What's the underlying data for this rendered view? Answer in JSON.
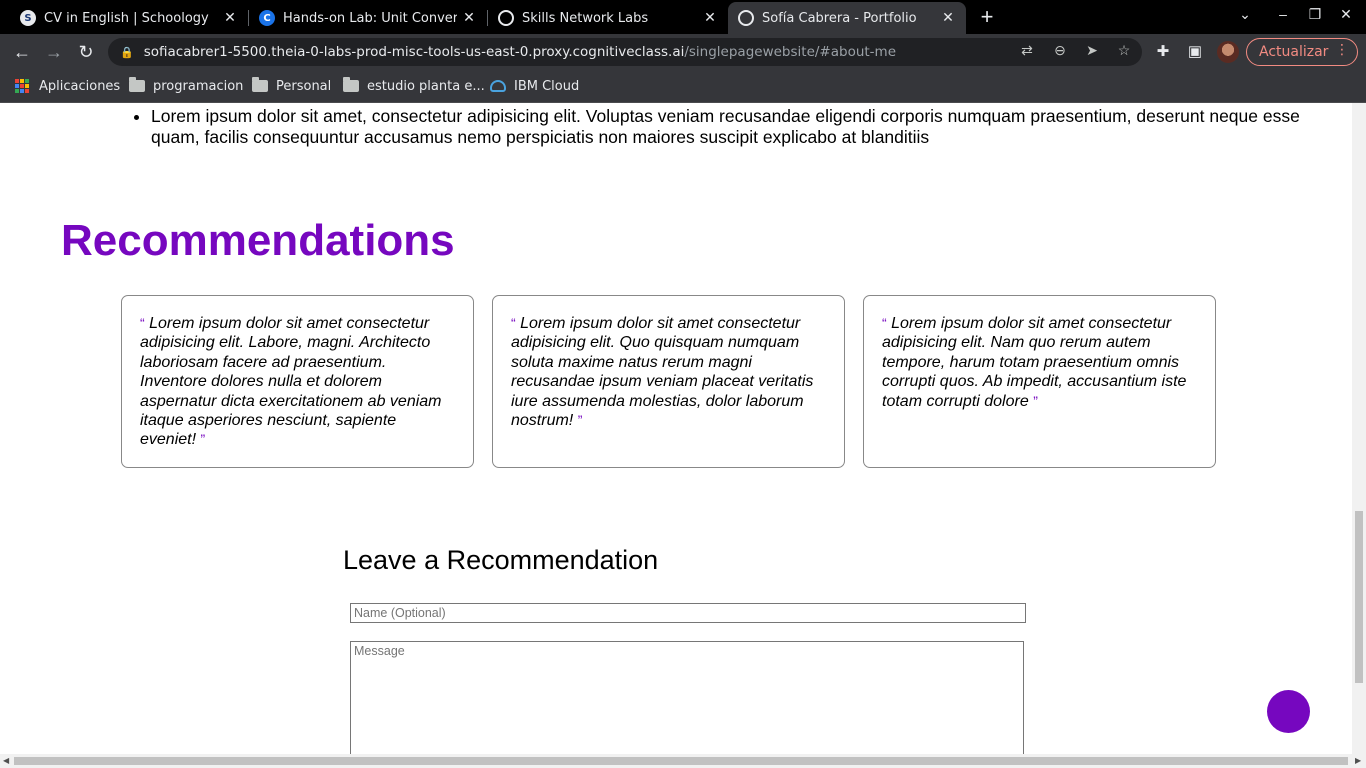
{
  "tabs": [
    {
      "title": "CV in English | Schoology",
      "favicon": "schoology-icon",
      "close": "✕"
    },
    {
      "title": "Hands-on Lab: Unit Conversion",
      "favicon": "cognitiveclass-icon",
      "close": "✕"
    },
    {
      "title": "Skills Network Labs",
      "favicon": "globe-icon",
      "close": "✕"
    },
    {
      "title": "Sofía Cabrera - Portfolio",
      "favicon": "globe-icon",
      "close": "✕"
    }
  ],
  "address_bar": {
    "host": "sofiacabrer1-5500.theia-0-labs-prod-misc-tools-us-east-0.proxy.cognitiveclass.ai",
    "path": "/singlepagewebsite/#about-me"
  },
  "update_button": "Actualizar",
  "bookmarks": [
    {
      "label": "Aplicaciones",
      "icon": "apps-grid-icon"
    },
    {
      "label": "programacion",
      "icon": "folder-icon"
    },
    {
      "label": "Personal",
      "icon": "folder-icon"
    },
    {
      "label": "estudio planta e...",
      "icon": "folder-icon"
    },
    {
      "label": "IBM Cloud",
      "icon": "ibm-cloud-icon"
    }
  ],
  "page": {
    "about_bullet": "Lorem ipsum dolor sit amet, consectetur adipisicing elit. Voluptas veniam recusandae eligendi corporis numquam praesentium, deserunt neque esse quam, facilis consequuntur accusamus nemo perspiciatis non maiores suscipit explicabo at blanditiis",
    "recommendations_title": "Recommendations",
    "quote_open": "“",
    "quote_close": "”",
    "recommendations": [
      {
        "text": "Lorem ipsum dolor sit amet consectetur adipisicing elit. Labore, magni. Architecto laboriosam facere ad praesentium. Inventore dolores nulla et dolorem aspernatur dicta exercitationem ab veniam itaque asperiores nesciunt, sapiente eveniet!"
      },
      {
        "text": "Lorem ipsum dolor sit amet consectetur adipisicing elit. Quo quisquam numquam soluta maxime natus rerum magni recusandae ipsum veniam placeat veritatis iure assumenda molestias, dolor laborum nostrum!"
      },
      {
        "text": "Lorem ipsum dolor sit amet consectetur adipisicing elit. Nam quo rerum autem tempore, harum totam praesentium omnis corrupti quos. Ab impedit, accusantium iste totam corrupti dolore"
      }
    ],
    "leave_title": "Leave a Recommendation",
    "name_placeholder": "Name (Optional)",
    "message_placeholder": "Message"
  },
  "colors": {
    "accent": "#7607bf",
    "chrome_dark": "#35363a",
    "update_red": "#f28b82"
  }
}
